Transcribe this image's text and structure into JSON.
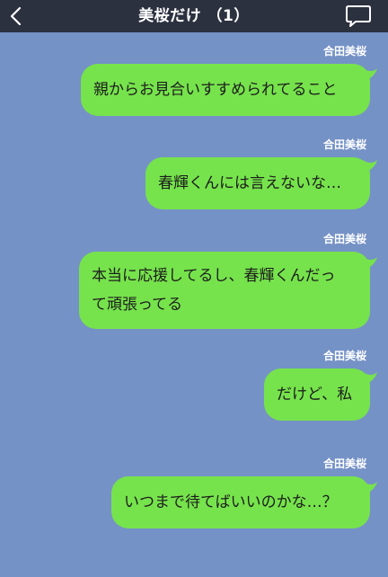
{
  "header": {
    "title": "美桜だけ （1）",
    "back_icon": "chevron-left-icon",
    "chat_icon": "speech-bubble-icon"
  },
  "colors": {
    "background": "#7592c6",
    "header": "#2c3140",
    "bubble": "#76e34c"
  },
  "messages": [
    {
      "sender": "合田美桜",
      "lines": [
        "親からお見合いすすめられてること"
      ]
    },
    {
      "sender": "合田美桜",
      "lines": [
        "春輝くんには言えないな…"
      ]
    },
    {
      "sender": "合田美桜",
      "lines": [
        "本当に応援してるし、春輝くんだっ",
        "て頑張ってる"
      ]
    },
    {
      "sender": "合田美桜",
      "lines": [
        "だけど、私"
      ]
    },
    {
      "sender": "合田美桜",
      "lines": [
        "いつまで待てばいいのかな…？"
      ]
    }
  ]
}
